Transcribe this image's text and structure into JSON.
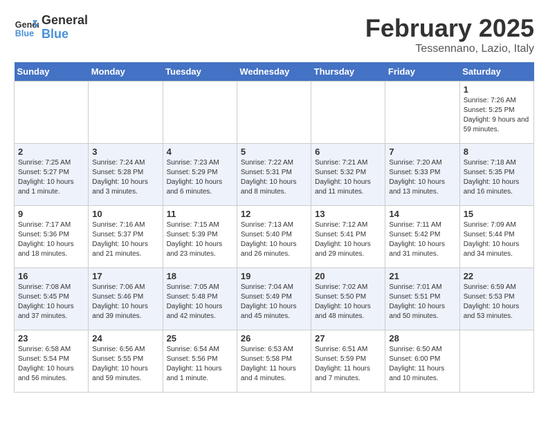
{
  "app": {
    "name": "GeneralBlue",
    "logo_color": "#4a90d9"
  },
  "calendar": {
    "title": "February 2025",
    "subtitle": "Tessennano, Lazio, Italy",
    "days_of_week": [
      "Sunday",
      "Monday",
      "Tuesday",
      "Wednesday",
      "Thursday",
      "Friday",
      "Saturday"
    ],
    "weeks": [
      [
        {
          "day": null
        },
        {
          "day": null
        },
        {
          "day": null
        },
        {
          "day": null
        },
        {
          "day": null
        },
        {
          "day": null
        },
        {
          "day": 1,
          "sunrise": "7:26 AM",
          "sunset": "5:25 PM",
          "daylight": "9 hours and 59 minutes."
        }
      ],
      [
        {
          "day": 2,
          "sunrise": "7:25 AM",
          "sunset": "5:27 PM",
          "daylight": "10 hours and 1 minute."
        },
        {
          "day": 3,
          "sunrise": "7:24 AM",
          "sunset": "5:28 PM",
          "daylight": "10 hours and 3 minutes."
        },
        {
          "day": 4,
          "sunrise": "7:23 AM",
          "sunset": "5:29 PM",
          "daylight": "10 hours and 6 minutes."
        },
        {
          "day": 5,
          "sunrise": "7:22 AM",
          "sunset": "5:31 PM",
          "daylight": "10 hours and 8 minutes."
        },
        {
          "day": 6,
          "sunrise": "7:21 AM",
          "sunset": "5:32 PM",
          "daylight": "10 hours and 11 minutes."
        },
        {
          "day": 7,
          "sunrise": "7:20 AM",
          "sunset": "5:33 PM",
          "daylight": "10 hours and 13 minutes."
        },
        {
          "day": 8,
          "sunrise": "7:18 AM",
          "sunset": "5:35 PM",
          "daylight": "10 hours and 16 minutes."
        }
      ],
      [
        {
          "day": 9,
          "sunrise": "7:17 AM",
          "sunset": "5:36 PM",
          "daylight": "10 hours and 18 minutes."
        },
        {
          "day": 10,
          "sunrise": "7:16 AM",
          "sunset": "5:37 PM",
          "daylight": "10 hours and 21 minutes."
        },
        {
          "day": 11,
          "sunrise": "7:15 AM",
          "sunset": "5:39 PM",
          "daylight": "10 hours and 23 minutes."
        },
        {
          "day": 12,
          "sunrise": "7:13 AM",
          "sunset": "5:40 PM",
          "daylight": "10 hours and 26 minutes."
        },
        {
          "day": 13,
          "sunrise": "7:12 AM",
          "sunset": "5:41 PM",
          "daylight": "10 hours and 29 minutes."
        },
        {
          "day": 14,
          "sunrise": "7:11 AM",
          "sunset": "5:42 PM",
          "daylight": "10 hours and 31 minutes."
        },
        {
          "day": 15,
          "sunrise": "7:09 AM",
          "sunset": "5:44 PM",
          "daylight": "10 hours and 34 minutes."
        }
      ],
      [
        {
          "day": 16,
          "sunrise": "7:08 AM",
          "sunset": "5:45 PM",
          "daylight": "10 hours and 37 minutes."
        },
        {
          "day": 17,
          "sunrise": "7:06 AM",
          "sunset": "5:46 PM",
          "daylight": "10 hours and 39 minutes."
        },
        {
          "day": 18,
          "sunrise": "7:05 AM",
          "sunset": "5:48 PM",
          "daylight": "10 hours and 42 minutes."
        },
        {
          "day": 19,
          "sunrise": "7:04 AM",
          "sunset": "5:49 PM",
          "daylight": "10 hours and 45 minutes."
        },
        {
          "day": 20,
          "sunrise": "7:02 AM",
          "sunset": "5:50 PM",
          "daylight": "10 hours and 48 minutes."
        },
        {
          "day": 21,
          "sunrise": "7:01 AM",
          "sunset": "5:51 PM",
          "daylight": "10 hours and 50 minutes."
        },
        {
          "day": 22,
          "sunrise": "6:59 AM",
          "sunset": "5:53 PM",
          "daylight": "10 hours and 53 minutes."
        }
      ],
      [
        {
          "day": 23,
          "sunrise": "6:58 AM",
          "sunset": "5:54 PM",
          "daylight": "10 hours and 56 minutes."
        },
        {
          "day": 24,
          "sunrise": "6:56 AM",
          "sunset": "5:55 PM",
          "daylight": "10 hours and 59 minutes."
        },
        {
          "day": 25,
          "sunrise": "6:54 AM",
          "sunset": "5:56 PM",
          "daylight": "11 hours and 1 minute."
        },
        {
          "day": 26,
          "sunrise": "6:53 AM",
          "sunset": "5:58 PM",
          "daylight": "11 hours and 4 minutes."
        },
        {
          "day": 27,
          "sunrise": "6:51 AM",
          "sunset": "5:59 PM",
          "daylight": "11 hours and 7 minutes."
        },
        {
          "day": 28,
          "sunrise": "6:50 AM",
          "sunset": "6:00 PM",
          "daylight": "11 hours and 10 minutes."
        },
        {
          "day": null
        }
      ]
    ]
  }
}
